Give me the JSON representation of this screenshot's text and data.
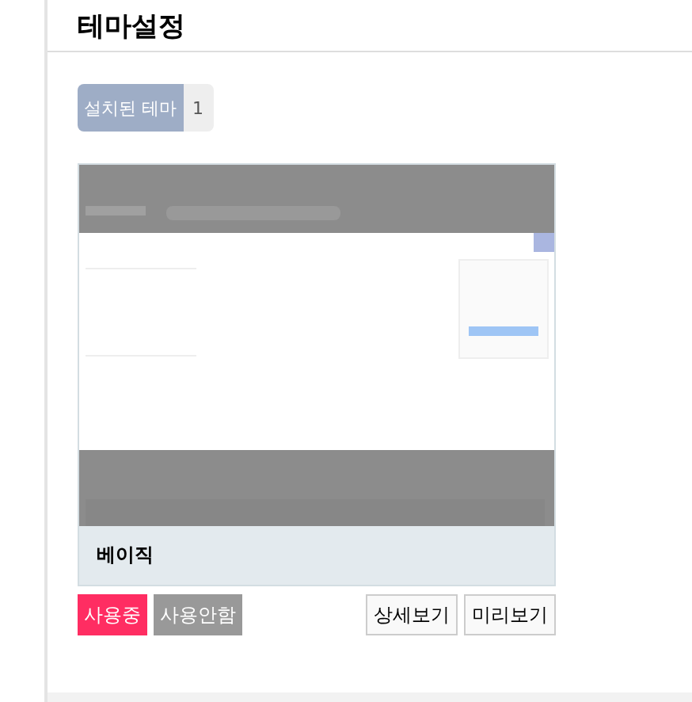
{
  "page_title": "테마설정",
  "installed": {
    "label": "설치된 테마",
    "count": "1"
  },
  "themes": [
    {
      "name": "베이직",
      "actions": [
        {
          "label": "사용중",
          "kind": "active"
        },
        {
          "label": "사용안함",
          "kind": "muted"
        },
        {
          "label": "상세보기",
          "kind": "outline"
        },
        {
          "label": "미리보기",
          "kind": "outline"
        }
      ]
    }
  ]
}
